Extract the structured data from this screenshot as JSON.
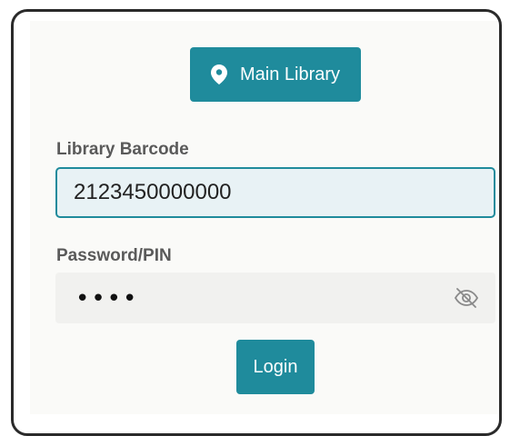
{
  "location": {
    "label": "Main Library",
    "icon": "map-pin-icon"
  },
  "barcode": {
    "label": "Library Barcode",
    "value": "2123450000000"
  },
  "pin": {
    "label": "Password/PIN",
    "masked_value": "••••",
    "toggle_icon": "eye-slash-icon"
  },
  "login": {
    "label": "Login"
  },
  "colors": {
    "accent": "#1f8b9c",
    "input_bg": "#e8f2f5",
    "card_bg": "#fafaf8"
  }
}
